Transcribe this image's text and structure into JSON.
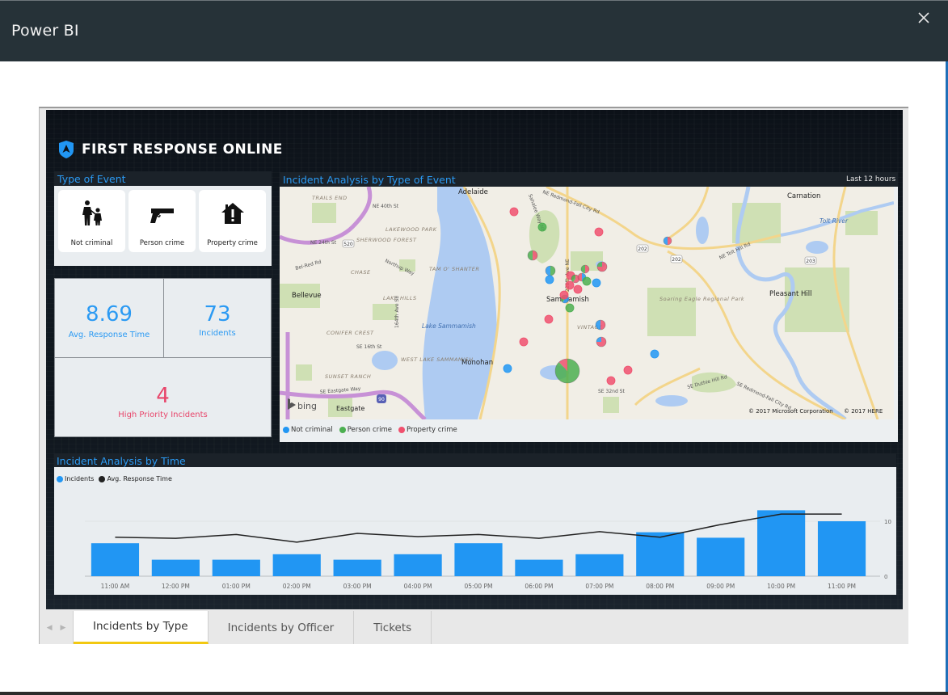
{
  "window": {
    "title": "Power BI",
    "close_icon": "close-x-icon"
  },
  "dashboard": {
    "brand_title": "FIRST RESPONSE ONLINE",
    "brand_icon": "police-badge-icon",
    "accent_color": "#2b9af3",
    "alert_color": "#e8456a"
  },
  "type_of_event": {
    "title": "Type of Event",
    "cards": [
      {
        "label": "Not criminal",
        "icon": "parent-child-icon"
      },
      {
        "label": "Person crime",
        "icon": "handgun-icon"
      },
      {
        "label": "Property crime",
        "icon": "house-alert-icon"
      }
    ]
  },
  "kpis": {
    "avg_response": {
      "value": "8.69",
      "label": "Avg. Response Time"
    },
    "incidents": {
      "value": "73",
      "label": "Incidents"
    },
    "high_priority": {
      "value": "4",
      "label": "High Priority Incidents"
    }
  },
  "map": {
    "title": "Incident Analysis by Type of Event",
    "timeframe": "Last 12 hours",
    "place_labels": [
      "Adelaide",
      "Carnation",
      "Bellevue",
      "Sammamish",
      "Pleasant Hill",
      "Monohan",
      "Eastgate",
      "Lake Sammamish",
      "Tolt River"
    ],
    "neighborhood_labels": [
      "TRAILS END",
      "LAKEWOOD PARK",
      "SHERWOOD FOREST",
      "CHASE",
      "TAM O' SHANTER",
      "LAKE HILLS",
      "CONIFER CREST",
      "WEST LAKE SAMMAMISH",
      "SUNSET RANCH",
      "VINTAGE",
      "Soaring Eagle Regional Park"
    ],
    "road_labels": [
      "NE 40th St",
      "NE 24th St",
      "Bel-Red Rd",
      "Northup Way",
      "SE 16th St",
      "SE Eastgate Way",
      "164th Ave SE",
      "Sahalee Way NE",
      "228th Ave NE",
      "NE Redmond-Fall City Rd",
      "NE Tolt Hill Rd",
      "SE Duthie Hill Rd",
      "SE Redmond-Fall City Rd",
      "SE 32nd St"
    ],
    "highway_shields": [
      "520",
      "202",
      "202",
      "203",
      "90"
    ],
    "provider": "bing",
    "copyright": "© 2017 Microsoft Corporation",
    "copyright2": "© 2017 HERE",
    "legend": [
      {
        "label": "Not criminal",
        "color": "#2196f3"
      },
      {
        "label": "Person crime",
        "color": "#4caf50"
      },
      {
        "label": "Property crime",
        "color": "#f0506e"
      }
    ]
  },
  "time_analysis": {
    "title": "Incident Analysis by Time",
    "legend": [
      {
        "label": "Incidents",
        "color": "#2196f3"
      },
      {
        "label": "Avg. Response Time",
        "color": "#222222"
      }
    ]
  },
  "chart_data": {
    "type": "bar",
    "title": "Incident Analysis by Time",
    "categories": [
      "11:00 AM",
      "12:00 PM",
      "01:00 PM",
      "02:00 PM",
      "03:00 PM",
      "04:00 PM",
      "05:00 PM",
      "06:00 PM",
      "07:00 PM",
      "08:00 PM",
      "09:00 PM",
      "10:00 PM",
      "11:00 PM"
    ],
    "series": [
      {
        "name": "Incidents",
        "type": "bar",
        "color": "#2196f3",
        "values": [
          6,
          3,
          3,
          4,
          3,
          4,
          6,
          3,
          4,
          8,
          7,
          12,
          10
        ]
      },
      {
        "name": "Avg. Response Time",
        "type": "line",
        "color": "#222222",
        "values": [
          7.1,
          6.9,
          7.6,
          6.2,
          7.8,
          7.2,
          7.6,
          6.9,
          8.1,
          7.1,
          9.4,
          11.3,
          11.3
        ]
      }
    ],
    "y_ticks": [
      "0",
      "10"
    ],
    "ylim": [
      0,
      15
    ],
    "grid": true,
    "legend_position": "top-left",
    "xlabel": "",
    "ylabel": ""
  },
  "tabs": {
    "prev_icon": "chevron-left-icon",
    "next_icon": "chevron-right-icon",
    "items": [
      {
        "label": "Incidents by Type",
        "active": true
      },
      {
        "label": "Incidents by Officer",
        "active": false
      },
      {
        "label": "Tickets",
        "active": false
      }
    ]
  }
}
